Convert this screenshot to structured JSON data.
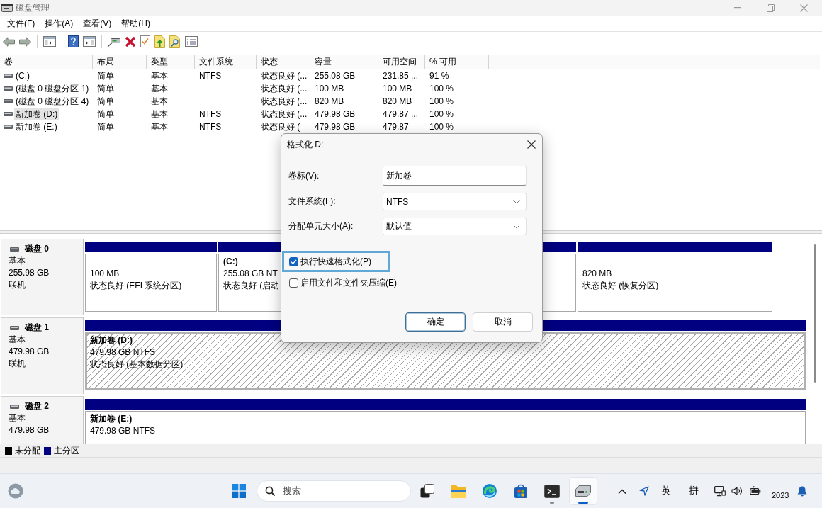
{
  "window": {
    "title": "磁盘管理"
  },
  "menu": [
    {
      "label": "文件(F)"
    },
    {
      "label": "操作(A)"
    },
    {
      "label": "查看(V)"
    },
    {
      "label": "帮助(H)"
    }
  ],
  "volumes": {
    "columns": [
      "卷",
      "布局",
      "类型",
      "文件系统",
      "状态",
      "容量",
      "可用空间",
      "% 可用"
    ],
    "rows": [
      {
        "volume": "(C:)",
        "layout": "简单",
        "type": "基本",
        "file_system": "NTFS",
        "status": "状态良好 (...",
        "capacity": "255.08 GB",
        "free_space": "231.85 ...",
        "percent_free": "91 %",
        "selected": false
      },
      {
        "volume": "(磁盘 0 磁盘分区 1)",
        "layout": "简单",
        "type": "基本",
        "status": "状态良好 (...",
        "capacity": "100 MB",
        "free_space": "100 MB",
        "percent_free": "100 %",
        "selected": false
      },
      {
        "volume": "(磁盘 0 磁盘分区 4)",
        "layout": "简单",
        "type": "基本",
        "status": "状态良好 (...",
        "capacity": "820 MB",
        "free_space": "820 MB",
        "percent_free": "100 %",
        "selected": false
      },
      {
        "volume": "新加卷 (D:)",
        "layout": "简单",
        "type": "基本",
        "file_system": "NTFS",
        "status": "状态良好 (...",
        "capacity": "479.98 GB",
        "free_space": "479.87 ...",
        "percent_free": "100 %",
        "selected": true
      },
      {
        "volume": "新加卷 (E:)",
        "layout": "简单",
        "type": "基本",
        "file_system": "NTFS",
        "status": "状态良好 (",
        "capacity": "479.98 GB",
        "free_space": "479.87",
        "percent_free": "100 %",
        "selected": false
      }
    ]
  },
  "disks": [
    {
      "name": "磁盘 0",
      "type": "基本",
      "size": "255.98 GB",
      "status": "联机",
      "partitions": [
        {
          "kind": "primary",
          "size": "100 MB",
          "status": "状态良好 (EFI 系统分区)",
          "selected": false
        },
        {
          "kind": "primary",
          "label": "(C:)",
          "size": "255.08 GB NT",
          "status": "状态良好 (启动",
          "selected": false
        },
        {
          "kind": "primary",
          "size": "820 MB",
          "status": "状态良好 (恢复分区)",
          "selected": false
        }
      ]
    },
    {
      "name": "磁盘 1",
      "type": "基本",
      "size": "479.98 GB",
      "status": "联机",
      "partitions": [
        {
          "kind": "primary",
          "label": "新加卷 (D:)",
          "size": "479.98 GB NTFS",
          "status": "状态良好 (基本数据分区)",
          "selected": true
        }
      ]
    },
    {
      "name": "磁盘 2",
      "type": "基本",
      "size": "479.98 GB",
      "partitions": [
        {
          "kind": "primary",
          "label": "新加卷 (E:)",
          "size": "479.98 GB NTFS",
          "selected": false
        }
      ]
    }
  ],
  "legend": [
    {
      "label": "未分配",
      "color": "#000000"
    },
    {
      "label": "主分区",
      "color": "#000080"
    }
  ],
  "dialog": {
    "title": "格式化 D:",
    "fields": [
      {
        "kind": "text",
        "label": "卷标(V):",
        "value": "新加卷"
      },
      {
        "kind": "select",
        "label": "文件系统(F):",
        "value": "NTFS"
      },
      {
        "kind": "select",
        "label": "分配单元大小(A):",
        "value": "默认值"
      }
    ],
    "options": [
      {
        "label": "执行快速格式化(P)",
        "checked": true,
        "focused": true
      },
      {
        "label": "启用文件和文件夹压缩(E)",
        "checked": false,
        "focused": false
      }
    ],
    "buttons": [
      {
        "label": "确定",
        "default": true
      },
      {
        "label": "取消",
        "default": false
      }
    ]
  },
  "taskbar": {
    "search": {
      "placeholder": "搜索"
    },
    "apps": [
      {
        "kind": "task-view",
        "running": false,
        "active": false
      },
      {
        "kind": "file-explorer",
        "running": false,
        "active": false
      },
      {
        "kind": "browser",
        "running": false,
        "active": false
      },
      {
        "kind": "store",
        "running": false,
        "active": false
      },
      {
        "kind": "terminal",
        "running": true,
        "active": false
      },
      {
        "kind": "disk-management",
        "running": true,
        "active": true
      }
    ],
    "tray": {
      "language": "英",
      "ime": "拼",
      "clock": "2023"
    }
  }
}
